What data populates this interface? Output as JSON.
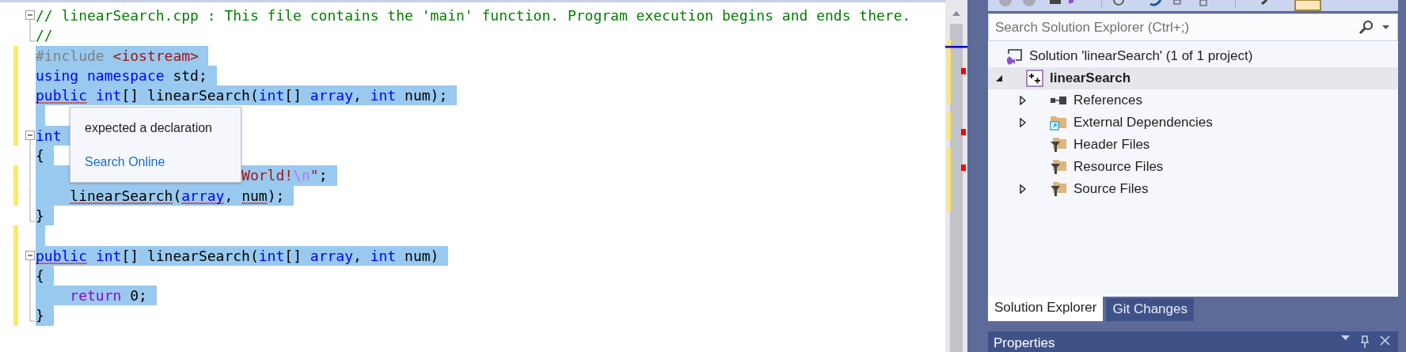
{
  "editor": {
    "lines": [
      {
        "kind": "fold-start",
        "changed": false,
        "selected": false,
        "tokens": [
          {
            "text": "// linearSearch.cpp : This file contains the 'main' function. Program execution begins and ends there.",
            "kind": "comment",
            "error": false
          }
        ]
      },
      {
        "kind": "fold-end",
        "changed": false,
        "selected": false,
        "tokens": [
          {
            "text": "//",
            "kind": "comment",
            "error": false
          }
        ]
      },
      {
        "kind": "plain",
        "changed": true,
        "selected": true,
        "tokens": [
          {
            "text": "#include",
            "kind": "preprocessor",
            "error": false
          },
          {
            "text": " <iostream>",
            "kind": "string",
            "error": false
          }
        ]
      },
      {
        "kind": "plain",
        "changed": true,
        "selected": true,
        "tokens": [
          {
            "text": "using",
            "kind": "keyword",
            "error": false
          },
          {
            "text": " namespace",
            "kind": "keyword",
            "error": false
          },
          {
            "text": " std;",
            "kind": "plain",
            "error": false
          }
        ]
      },
      {
        "kind": "plain",
        "changed": true,
        "selected": true,
        "tokens": [
          {
            "text": "public",
            "kind": "keyword",
            "error": true
          },
          {
            "text": " int",
            "kind": "keyword",
            "error": false
          },
          {
            "text": "[] linearSearch(",
            "kind": "plain",
            "error": false
          },
          {
            "text": "int",
            "kind": "keyword",
            "error": false
          },
          {
            "text": "[] ",
            "kind": "plain",
            "error": false
          },
          {
            "text": "array",
            "kind": "keyword",
            "error": false
          },
          {
            "text": ", ",
            "kind": "plain",
            "error": false
          },
          {
            "text": "int",
            "kind": "keyword",
            "error": false
          },
          {
            "text": " num);",
            "kind": "plain",
            "error": false
          }
        ]
      },
      {
        "kind": "plain",
        "changed": true,
        "selected": true
      },
      {
        "kind": "fold-start",
        "changed": true,
        "selected": true,
        "tokens": [
          {
            "text": "int",
            "kind": "keyword",
            "error": false
          }
        ]
      },
      {
        "kind": "fold-body",
        "changed": false,
        "selected": true,
        "tokens": [
          {
            "text": "{",
            "kind": "plain",
            "error": false
          }
        ]
      },
      {
        "kind": "fold-body",
        "changed": true,
        "selected": true,
        "tokens": [
          {
            "text": "                        World!",
            "kind": "string",
            "error": false
          },
          {
            "text": "\\n",
            "kind": "escape",
            "error": false
          },
          {
            "text": "\"",
            "kind": "string",
            "error": false
          },
          {
            "text": ";",
            "kind": "plain",
            "error": false
          }
        ]
      },
      {
        "kind": "fold-body",
        "changed": true,
        "selected": true,
        "tokens": [
          {
            "text": "    linearSearch",
            "kind": "plain",
            "error": true
          },
          {
            "text": "(",
            "kind": "plain",
            "error": false
          },
          {
            "text": "array",
            "kind": "keyword",
            "error": true
          },
          {
            "text": ", ",
            "kind": "plain",
            "error": false
          },
          {
            "text": "num",
            "kind": "plain",
            "error": true
          },
          {
            "text": ");",
            "kind": "plain",
            "error": false
          }
        ]
      },
      {
        "kind": "fold-end",
        "changed": false,
        "selected": true,
        "tokens": [
          {
            "text": "}",
            "kind": "plain",
            "error": false
          }
        ]
      },
      {
        "kind": "plain",
        "changed": true,
        "selected": true
      },
      {
        "kind": "fold-start",
        "changed": true,
        "selected": true,
        "tokens": [
          {
            "text": "public",
            "kind": "keyword",
            "error": true
          },
          {
            "text": " int",
            "kind": "keyword",
            "error": false
          },
          {
            "text": "[] linearSearch(",
            "kind": "plain",
            "error": false
          },
          {
            "text": "int",
            "kind": "keyword",
            "error": false
          },
          {
            "text": "[] ",
            "kind": "plain",
            "error": false
          },
          {
            "text": "array",
            "kind": "keyword",
            "error": false
          },
          {
            "text": ", ",
            "kind": "plain",
            "error": false
          },
          {
            "text": "int",
            "kind": "keyword",
            "error": false
          },
          {
            "text": " num)",
            "kind": "plain",
            "error": false
          }
        ]
      },
      {
        "kind": "fold-body",
        "changed": true,
        "selected": true,
        "tokens": [
          {
            "text": "{",
            "kind": "plain",
            "error": false
          }
        ]
      },
      {
        "kind": "fold-body",
        "changed": true,
        "selected": true,
        "tokens": [
          {
            "text": "    return",
            "kind": "control",
            "error": false
          },
          {
            "text": " 0;",
            "kind": "plain",
            "error": false
          }
        ]
      },
      {
        "kind": "fold-end",
        "changed": true,
        "selected": true,
        "tokens": [
          {
            "text": "}",
            "kind": "plain",
            "error": false
          }
        ]
      }
    ]
  },
  "tooltip": {
    "message": "expected a declaration",
    "link": "Search Online"
  },
  "solution_explorer": {
    "search": {
      "placeholder": "Search Solution Explorer (Ctrl+;)"
    },
    "tree": [
      {
        "label": "Solution 'linearSearch' (1 of 1 project)",
        "kind": "solution",
        "selected": false,
        "children": [
          {
            "label": "linearSearch",
            "kind": "project",
            "selected": true,
            "startup": true,
            "expanded": true,
            "children": [
              {
                "label": "References",
                "kind": "references",
                "selected": false,
                "expanded": false
              },
              {
                "label": "External Dependencies",
                "kind": "external",
                "selected": false,
                "expanded": false
              },
              {
                "label": "Header Files",
                "kind": "filter",
                "selected": false
              },
              {
                "label": "Resource Files",
                "kind": "filter",
                "selected": false
              },
              {
                "label": "Source Files",
                "kind": "filter",
                "selected": false,
                "expanded": false
              }
            ]
          }
        ]
      }
    ],
    "tabs": [
      {
        "label": "Solution Explorer",
        "selected": true
      },
      {
        "label": "Git Changes",
        "selected": false
      }
    ]
  },
  "properties": {
    "title": "Properties"
  }
}
